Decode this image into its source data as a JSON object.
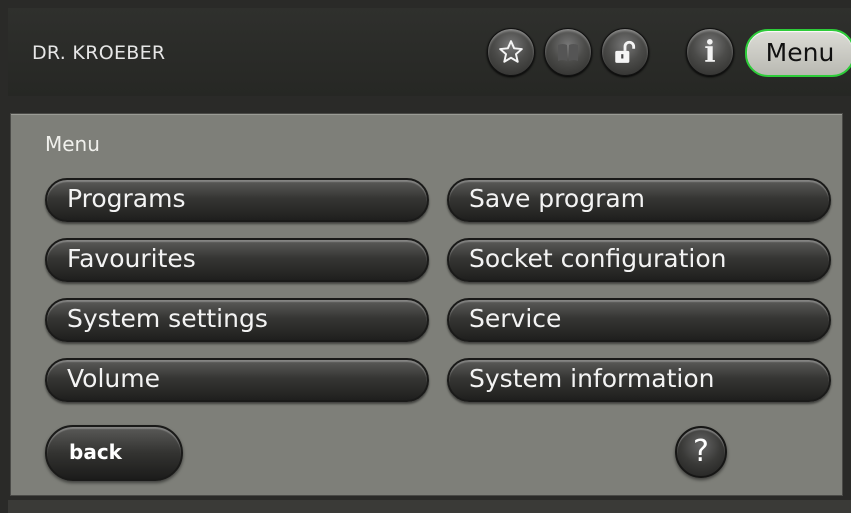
{
  "header": {
    "device_name": "DR. KROEBER",
    "icons": {
      "favourite": "star-icon",
      "book": "book-icon",
      "lock": "unlock-icon",
      "info": "info-icon"
    },
    "info_glyph": "i",
    "menu_label": "Menu",
    "menu_active_color": "#2ecc3a"
  },
  "panel": {
    "title": "Menu",
    "items_left": [
      "Programs",
      "Favourites",
      "System settings",
      "Volume"
    ],
    "items_right": [
      "Save program",
      "Socket configuration",
      "Service",
      "System information"
    ],
    "back_label": "back",
    "help_label": "?"
  }
}
